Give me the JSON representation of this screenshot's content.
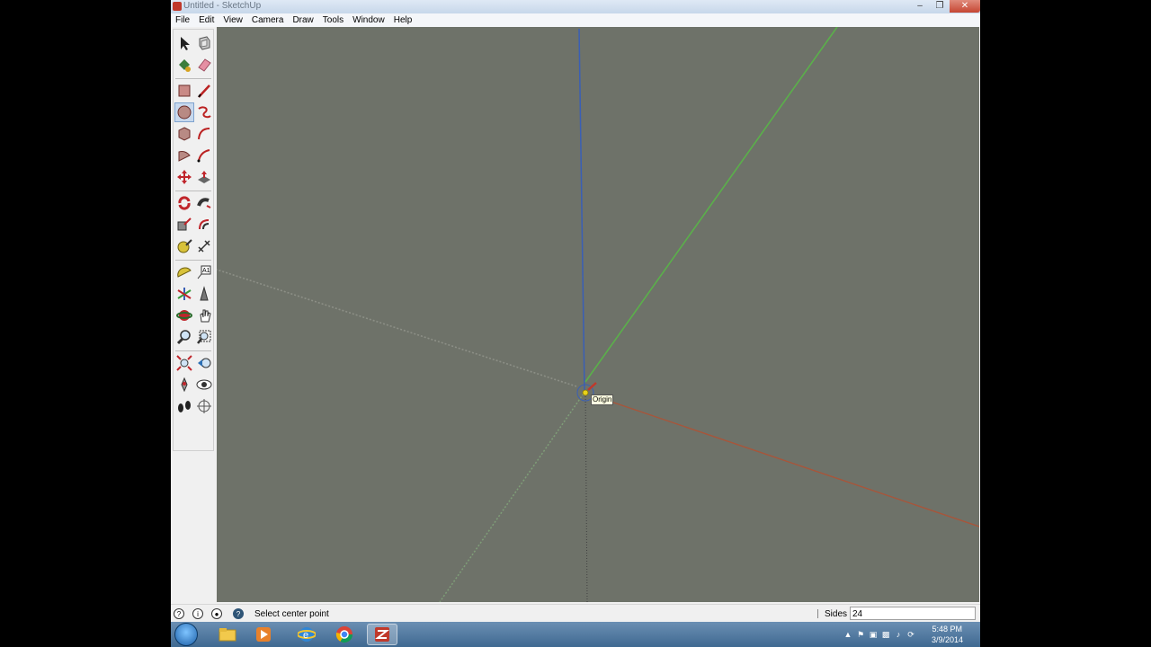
{
  "window": {
    "title": "Untitled - SketchUp",
    "controls": [
      "minimize",
      "restore",
      "close"
    ]
  },
  "menu": [
    "File",
    "Edit",
    "View",
    "Camera",
    "Draw",
    "Tools",
    "Window",
    "Help"
  ],
  "toolbar": {
    "tools": [
      {
        "name": "select-icon"
      },
      {
        "name": "make-component-icon"
      },
      {
        "name": "paint-bucket-icon"
      },
      {
        "name": "eraser-icon"
      },
      {
        "name": "rectangle-icon"
      },
      {
        "name": "line-icon"
      },
      {
        "name": "circle-icon",
        "active": true
      },
      {
        "name": "freehand-icon"
      },
      {
        "name": "polygon-icon"
      },
      {
        "name": "arc-icon"
      },
      {
        "name": "pie-icon"
      },
      {
        "name": "two-point-arc-icon"
      },
      {
        "name": "move-icon"
      },
      {
        "name": "push-pull-icon"
      },
      {
        "name": "rotate-icon"
      },
      {
        "name": "follow-me-icon"
      },
      {
        "name": "scale-icon"
      },
      {
        "name": "offset-icon"
      },
      {
        "name": "tape-measure-icon"
      },
      {
        "name": "dimension-icon"
      },
      {
        "name": "protractor-icon"
      },
      {
        "name": "text-icon"
      },
      {
        "name": "axes-icon"
      },
      {
        "name": "3d-text-icon"
      },
      {
        "name": "orbit-icon"
      },
      {
        "name": "pan-icon"
      },
      {
        "name": "zoom-icon"
      },
      {
        "name": "zoom-window-icon"
      },
      {
        "name": "zoom-extents-icon"
      },
      {
        "name": "previous-view-icon"
      },
      {
        "name": "position-camera-icon"
      },
      {
        "name": "look-around-icon"
      },
      {
        "name": "walk-icon"
      },
      {
        "name": "section-plane-icon"
      }
    ]
  },
  "viewport": {
    "tooltip": "Origin"
  },
  "status": {
    "icons": [
      "help-icon",
      "info-icon",
      "user-icon",
      "geolocation-icon"
    ],
    "message": "Select center point",
    "measure_label": "Sides",
    "measure_value": "24"
  },
  "taskbar": {
    "apps": [
      "file-explorer-icon",
      "media-player-icon",
      "ie-icon",
      "chrome-icon",
      "sketchup-icon"
    ],
    "active": "sketchup-icon",
    "time": "5:48 PM",
    "date": "3/9/2014"
  }
}
